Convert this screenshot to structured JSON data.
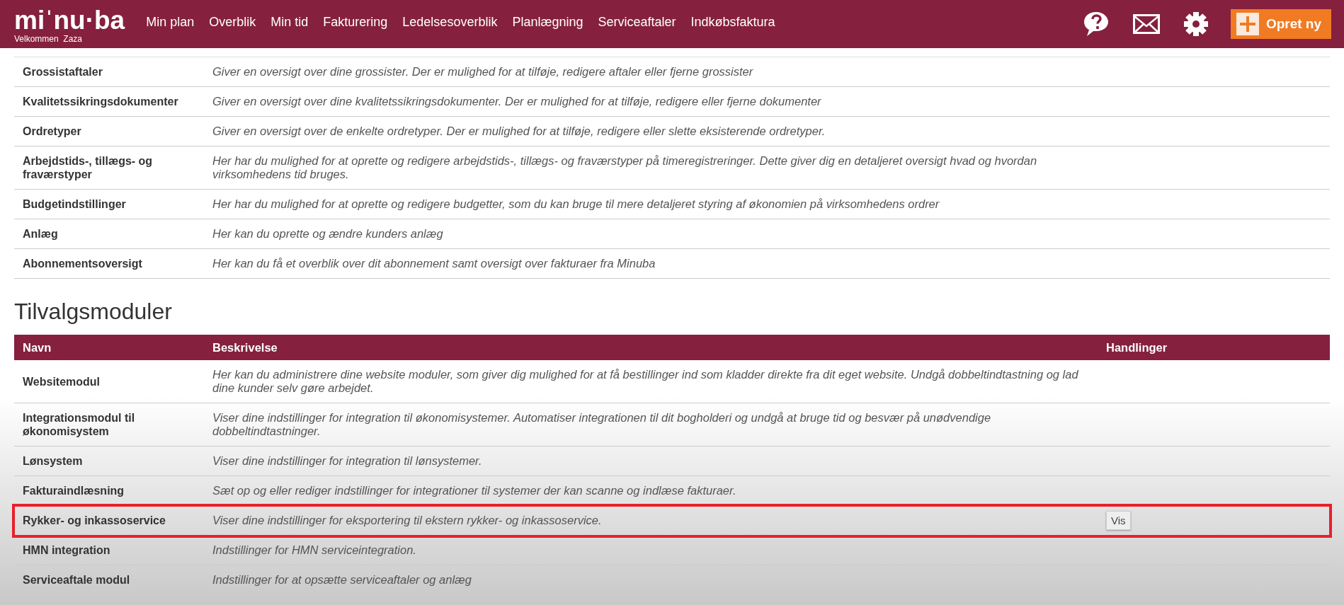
{
  "header": {
    "logo": "miˈnu·ba",
    "welcome": "Velkommen  Zaza",
    "nav": [
      "Min plan",
      "Overblik",
      "Min tid",
      "Fakturering",
      "Ledelsesoverblik",
      "Planlægning",
      "Serviceaftaler",
      "Indkøbsfaktura"
    ],
    "create_button": "Opret ny"
  },
  "settings_table": {
    "rows": [
      {
        "name": "Grossistaftaler",
        "description": "Giver en oversigt over dine grossister. Der er mulighed for at tilføje, redigere aftaler eller fjerne grossister"
      },
      {
        "name": "Kvalitetssikringsdokumenter",
        "description": "Giver en oversigt over dine kvalitetssikringsdokumenter. Der er mulighed for at tilføje, redigere eller fjerne dokumenter"
      },
      {
        "name": "Ordretyper",
        "description": "Giver en oversigt over de enkelte ordretyper. Der er mulighed for at tilføje, redigere eller slette eksisterende ordretyper."
      },
      {
        "name": "Arbejdstids-, tillægs- og fraværstyper",
        "description": "Her har du mulighed for at oprette og redigere arbejdstids-, tillægs- og fraværstyper på timeregistreringer. Dette giver dig en detaljeret oversigt hvad og hvordan virksomhedens tid bruges."
      },
      {
        "name": "Budgetindstillinger",
        "description": "Her har du mulighed for at oprette og redigere budgetter, som du kan bruge til mere detaljeret styring af økonomien på virksomhedens ordrer"
      },
      {
        "name": "Anlæg",
        "description": "Her kan du oprette og ændre kunders anlæg"
      },
      {
        "name": "Abonnementsoversigt",
        "description": "Her kan du få et overblik over dit abonnement samt oversigt over fakturaer fra Minuba"
      }
    ]
  },
  "modules": {
    "title": "Tilvalgsmoduler",
    "columns": [
      "Navn",
      "Beskrivelse",
      "Handlinger"
    ],
    "rows": [
      {
        "name": "Websitemodul",
        "description": "Her kan du administrere dine website moduler, som giver dig mulighed for at få bestillinger ind som kladder direkte fra dit eget website. Undgå dobbeltindtastning og lad dine kunder selv gøre arbejdet.",
        "highlighted": false
      },
      {
        "name": "Integrationsmodul til økonomisystem",
        "description": "Viser dine indstillinger for integration til økonomisystemer. Automatiser integrationen til dit bogholderi og undgå at bruge tid og besvær på unødvendige dobbeltindtastninger.",
        "highlighted": false
      },
      {
        "name": "Lønsystem",
        "description": "Viser dine indstillinger for integration til lønsystemer.",
        "highlighted": false
      },
      {
        "name": "Fakturaindlæsning",
        "description": "Sæt op og eller rediger indstillinger for integrationer til systemer der kan scanne og indlæse fakturaer.",
        "highlighted": false
      },
      {
        "name": "Rykker- og inkassoservice",
        "description": "Viser dine indstillinger for eksportering til ekstern rykker- og inkassoservice.",
        "highlighted": true,
        "action": "Vis"
      },
      {
        "name": "HMN integration",
        "description": "Indstillinger for HMN serviceintegration.",
        "highlighted": false
      },
      {
        "name": "Serviceaftale modul",
        "description": "Indstillinger for at opsætte serviceaftaler og anlæg",
        "highlighted": false
      }
    ]
  }
}
